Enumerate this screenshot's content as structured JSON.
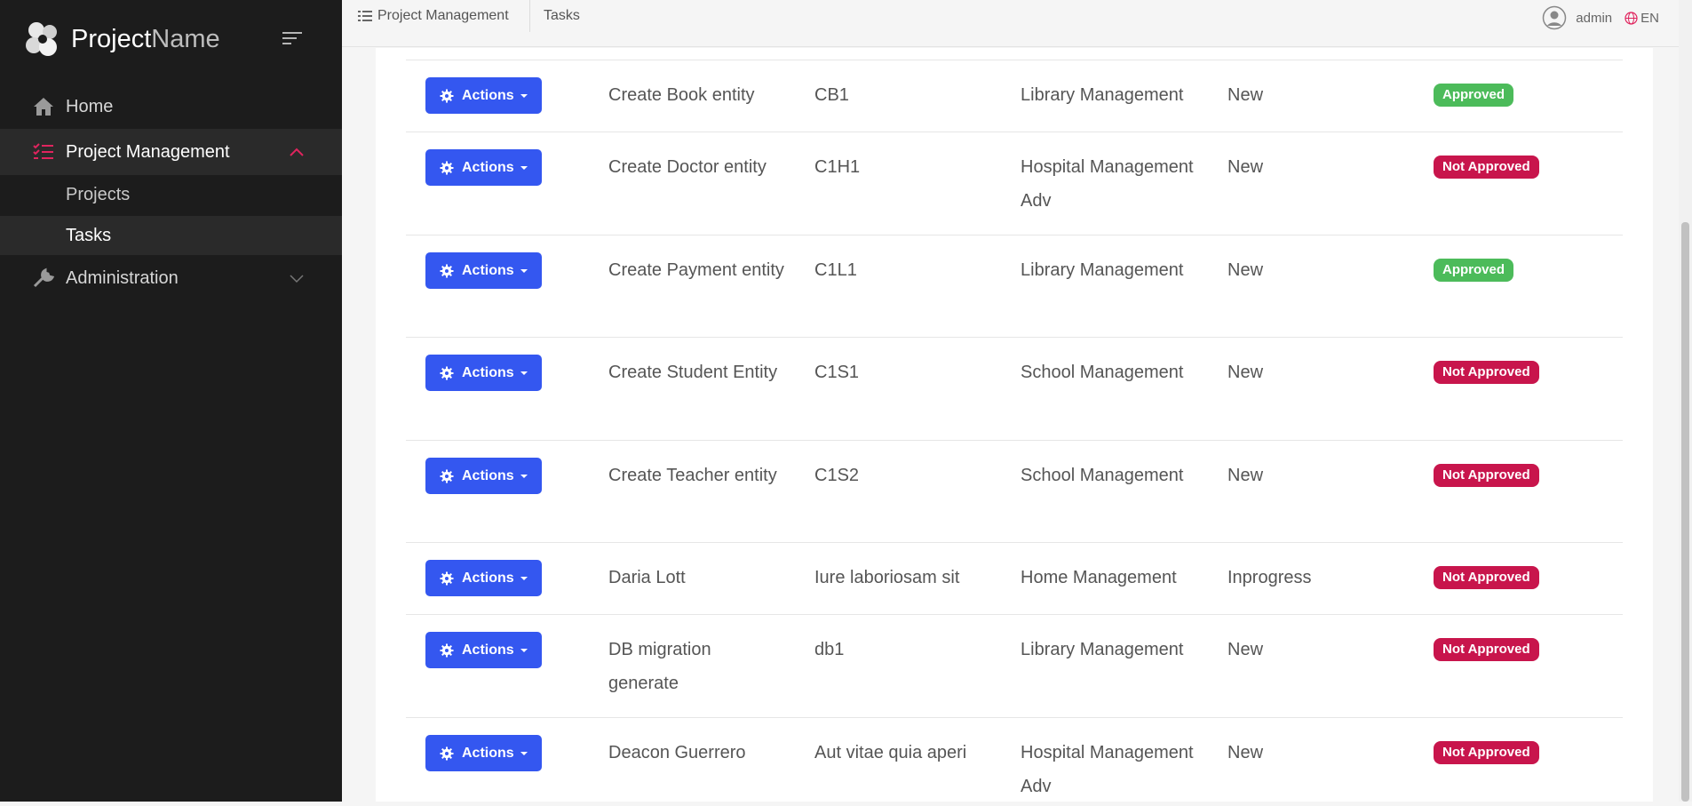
{
  "brand": {
    "name_primary": "Project",
    "name_secondary": "Name"
  },
  "sidebar": {
    "items": [
      {
        "label": "Home",
        "icon": "home-icon"
      },
      {
        "label": "Project Management",
        "icon": "list-check-icon",
        "expanded": true
      },
      {
        "label": "Administration",
        "icon": "wrench-icon",
        "expanded": false
      }
    ],
    "sub_items": [
      {
        "label": "Projects"
      },
      {
        "label": "Tasks",
        "active": true
      }
    ]
  },
  "header": {
    "breadcrumb": [
      "Project Management",
      "Tasks"
    ],
    "user": "admin",
    "language": "EN"
  },
  "colors": {
    "accent": "#3457f0",
    "active_pink": "#e0245e",
    "approved": "#4cbb5a",
    "not_approved": "#c8154c",
    "sidebar_bg": "#1c1c1c"
  },
  "table": {
    "action_label": "Actions",
    "rows": [
      {
        "name": "Create Book entity",
        "code": "CB1",
        "project": "Library Management",
        "status": "New",
        "approval": "Approved"
      },
      {
        "name": "Create Doctor entity",
        "code": "C1H1",
        "project": "Hospital Management Adv",
        "status": "New",
        "approval": "Not Approved"
      },
      {
        "name": "Create Payment entity",
        "code": "C1L1",
        "project": "Library Management",
        "status": "New",
        "approval": "Approved"
      },
      {
        "name": "Create Student Entity",
        "code": "C1S1",
        "project": "School Management",
        "status": "New",
        "approval": "Not Approved"
      },
      {
        "name": "Create Teacher entity",
        "code": "C1S2",
        "project": "School Management",
        "status": "New",
        "approval": "Not Approved"
      },
      {
        "name": "Daria Lott",
        "code": "Iure laboriosam sit",
        "project": "Home Management",
        "status": "Inprogress",
        "approval": "Not Approved"
      },
      {
        "name": "DB migration generate",
        "code": "db1",
        "project": "Library Management",
        "status": "New",
        "approval": "Not Approved"
      },
      {
        "name": "Deacon Guerrero",
        "code": "Aut vitae quia aperi",
        "project": "Hospital Management Adv",
        "status": "New",
        "approval": "Not Approved"
      }
    ]
  }
}
